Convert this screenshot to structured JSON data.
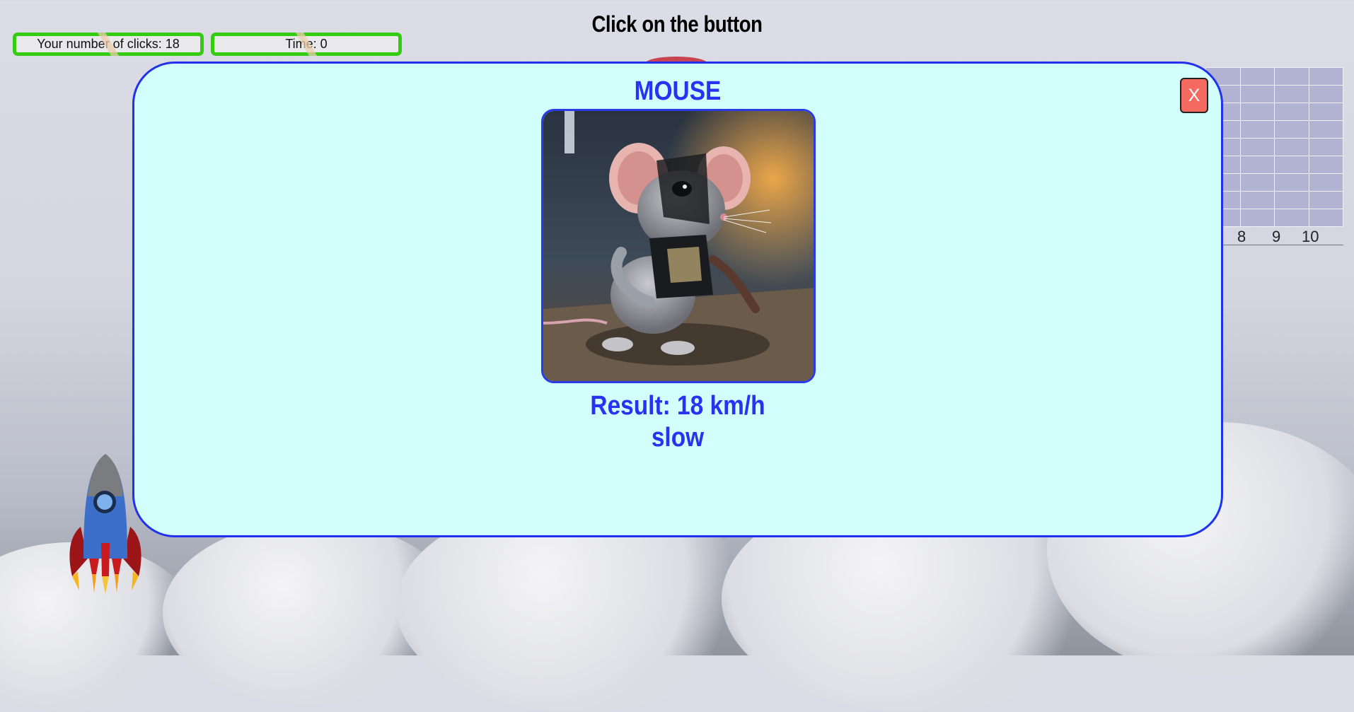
{
  "header": {
    "title": "Click on the button",
    "clicks_label": "Your number of clicks: 18",
    "time_label": "Time: 0"
  },
  "chart": {
    "axis_labels": [
      "8",
      "9",
      "10"
    ]
  },
  "modal": {
    "title": "MOUSE",
    "close_label": "X",
    "image_name": "robot-mouse-photo",
    "result_text": "Result: 18 km/h",
    "verdict_text": "slow"
  },
  "colors": {
    "accent": "#2533f3",
    "counter_border": "#33cc11",
    "modal_bg": "#d2fffb",
    "close_button": "#f46a60"
  }
}
